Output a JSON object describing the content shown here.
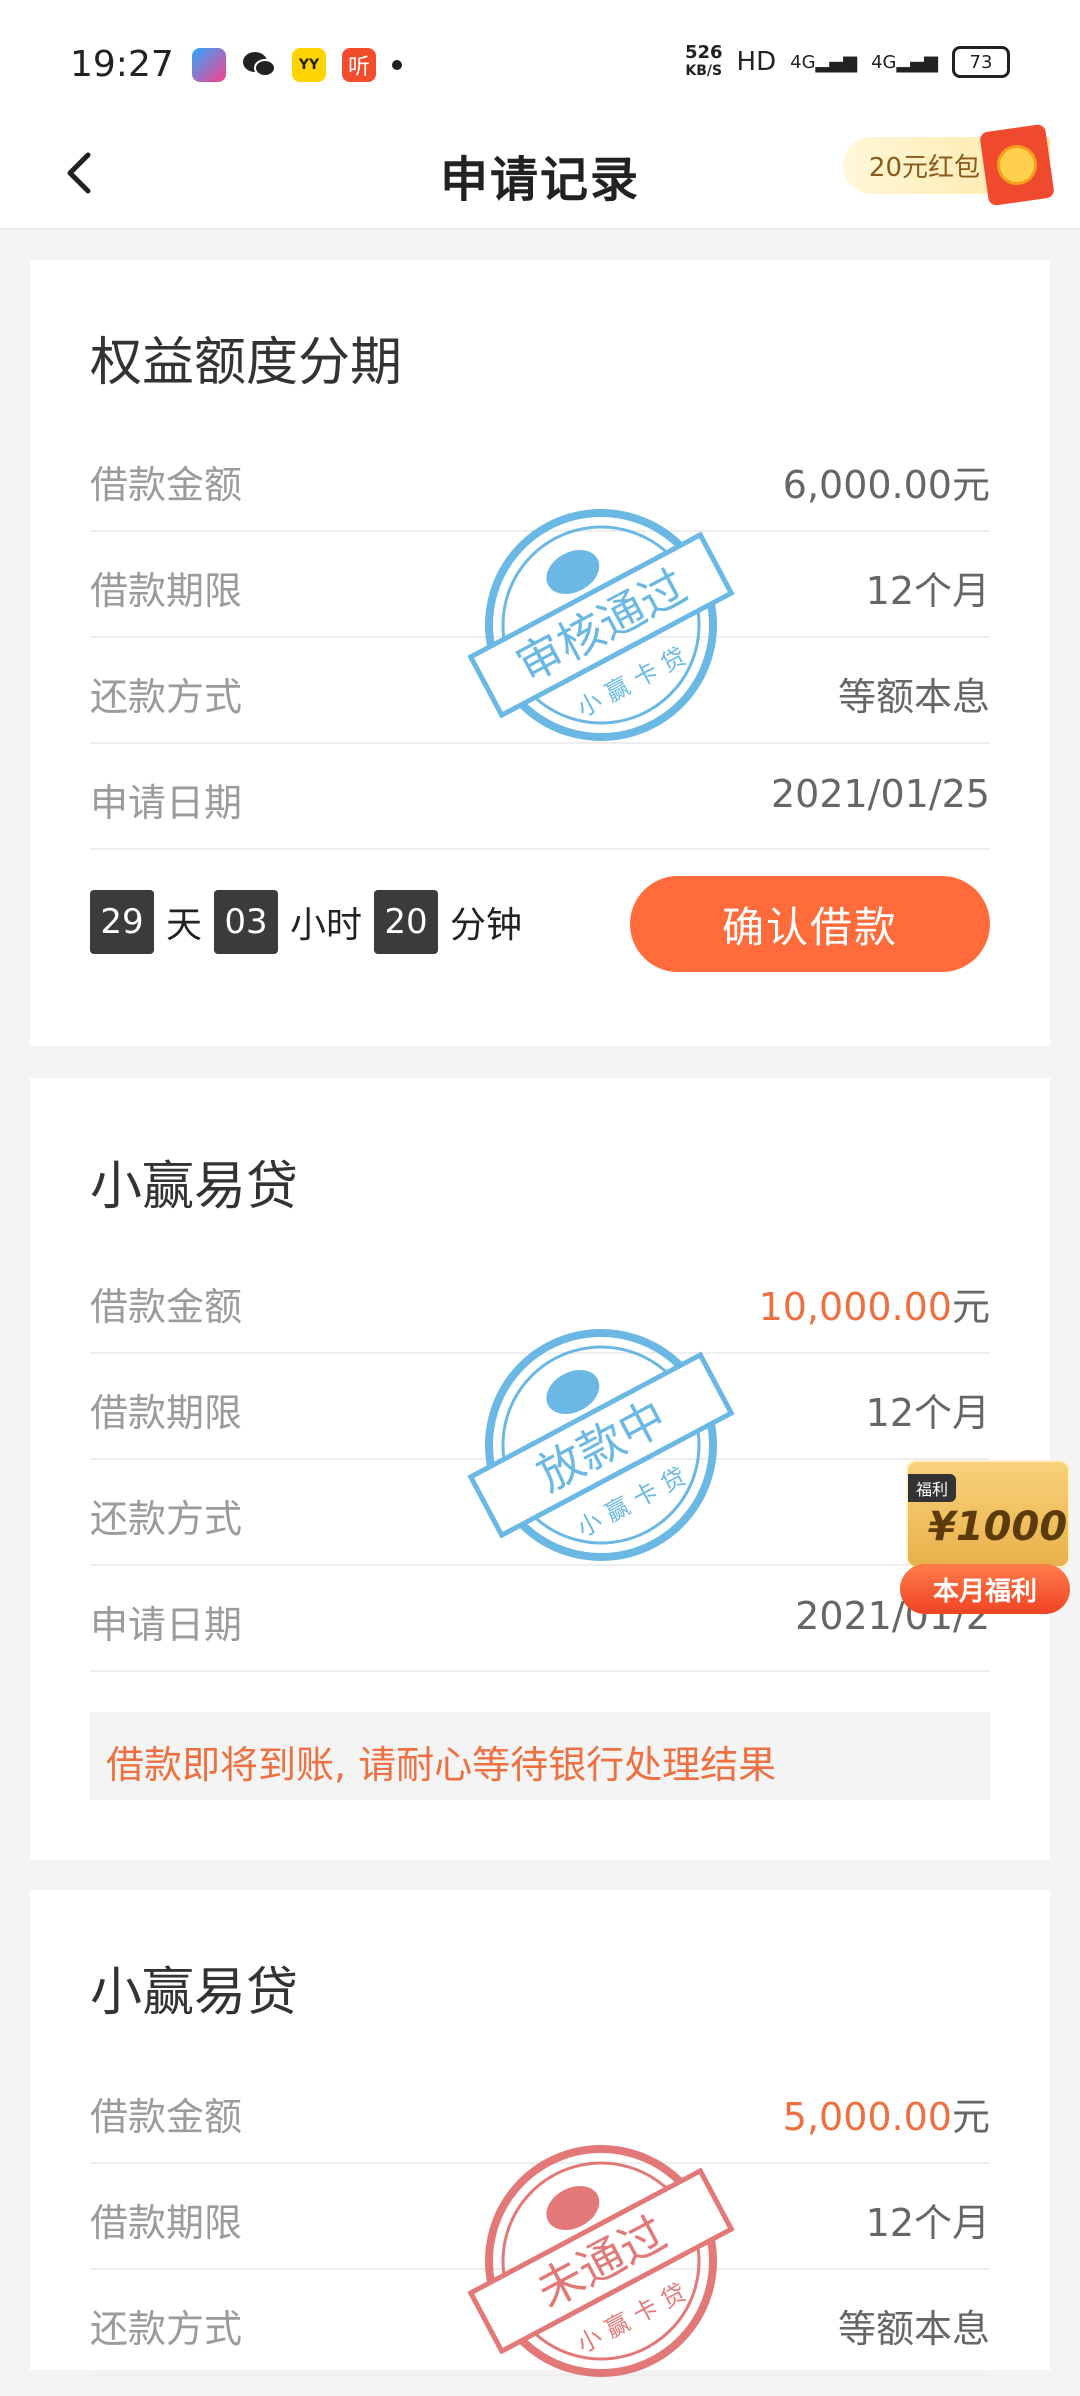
{
  "status_bar": {
    "time": "19:27",
    "net_speed_value": "526",
    "net_speed_unit": "KB/S",
    "hd_label": "HD",
    "network_1": "4G",
    "network_2": "4G",
    "battery": "73",
    "apps": [
      "youku-app-icon",
      "wechat-app-icon",
      "yy-app-icon",
      "ting-app-icon"
    ],
    "ting_label": "听",
    "yy_label": "YY"
  },
  "header": {
    "title": "申请记录",
    "red_packet_label": "20元红包"
  },
  "cards": [
    {
      "title": "权益额度分期",
      "rows": [
        {
          "label": "借款金额",
          "value_accent": "",
          "value": "6,000.00元"
        },
        {
          "label": "借款期限",
          "value": "12个月"
        },
        {
          "label": "还款方式",
          "value": "等额本息"
        },
        {
          "label": "申请日期",
          "value": "2021/01/25"
        }
      ],
      "stamp": {
        "text": "审核通过",
        "brand": "小 赢 卡 贷",
        "color": "#5ab1e0"
      },
      "countdown": {
        "days": "29",
        "days_unit": "天",
        "hours": "03",
        "hours_unit": "小时",
        "minutes": "20",
        "minutes_unit": "分钟"
      },
      "action_label": "确认借款"
    },
    {
      "title": "小赢易贷",
      "rows": [
        {
          "label": "借款金额",
          "value_accent": "10,000.00",
          "value": "元"
        },
        {
          "label": "借款期限",
          "value": "12个月"
        },
        {
          "label": "还款方式",
          "value": "等额"
        },
        {
          "label": "申请日期",
          "value": "2021/01/2"
        }
      ],
      "stamp": {
        "text": "放款中",
        "brand": "小 赢 卡 贷",
        "color": "#5ab1e0"
      },
      "notice": "借款即将到账, 请耐心等待银行处理结果"
    },
    {
      "title": "小赢易贷",
      "rows": [
        {
          "label": "借款金额",
          "value_accent": "5,000.00",
          "value": "元"
        },
        {
          "label": "借款期限",
          "value": "12个月"
        },
        {
          "label": "还款方式",
          "value": "等额本息"
        }
      ],
      "stamp": {
        "text": "未通过",
        "brand": "小 赢 卡 贷",
        "color": "#e06a6a"
      }
    }
  ],
  "welfare": {
    "tag": "福利",
    "amount": "¥1000",
    "button_label": "本月福利"
  },
  "colors": {
    "accent": "#ee7040",
    "button": "#ff6b3a",
    "stamp_blue": "#5ab1e0",
    "stamp_red": "#e06a6a"
  }
}
